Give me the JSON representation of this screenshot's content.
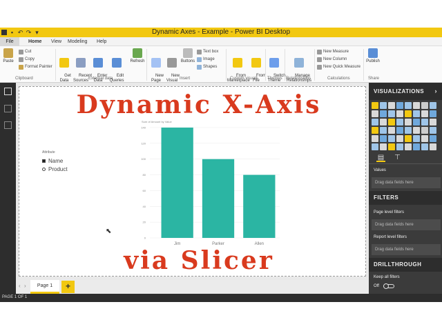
{
  "window": {
    "title": "Dynamic Axes - Example - Power BI Desktop"
  },
  "menu": {
    "file": "File",
    "tabs": [
      "Home",
      "View",
      "Modeling",
      "Help"
    ]
  },
  "ribbon": {
    "clipboard": {
      "paste": "Paste",
      "cut": "Cut",
      "copy": "Copy",
      "format_painter": "Format Painter",
      "group": "Clipboard"
    },
    "external_data": {
      "get_data": "Get\nData",
      "recent_sources": "Recent\nSources",
      "enter_data": "Enter\nData",
      "edit_queries": "Edit\nQueries",
      "refresh": "Refresh",
      "group": "External data"
    },
    "insert": {
      "new_page": "New\nPage",
      "new_visual": "New\nVisual",
      "buttons": "Buttons",
      "text_box": "Text box",
      "image": "Image",
      "shapes": "Shapes",
      "group": "Insert"
    },
    "custom_visuals": {
      "from_marketplace": "From\nMarketplace",
      "from_file": "From\nFile",
      "group": "Custom visuals"
    },
    "themes": {
      "switch_theme": "Switch\nTheme",
      "group": "Themes"
    },
    "relationships": {
      "manage": "Manage\nRelationships",
      "group": "Relationships"
    },
    "calculations": {
      "new_measure": "New Measure",
      "new_column": "New Column",
      "new_quick_measure": "New Quick Measure",
      "group": "Calculations"
    },
    "share": {
      "publish": "Publish",
      "group": "Share"
    }
  },
  "report": {
    "heading_top": "Dynamic X-Axis",
    "heading_bottom": "via Slicer",
    "slicer": {
      "label": "Attribute",
      "options": [
        {
          "label": "Name",
          "selected": true
        },
        {
          "label": "Product",
          "selected": false
        }
      ]
    }
  },
  "chart_data": {
    "type": "bar",
    "title": "Sum of Amount by Value",
    "categories": [
      "Jim",
      "Parker",
      "Allen"
    ],
    "values": [
      140,
      100,
      80
    ],
    "ylim": [
      0,
      140
    ],
    "yticks": [
      0,
      20,
      40,
      60,
      80,
      100,
      120,
      140
    ],
    "color": "#2bb5a3",
    "grid": true
  },
  "pages": {
    "tabs": [
      "Page 1"
    ],
    "add": "+"
  },
  "status": {
    "text": "PAGE 1 OF 1"
  },
  "pane": {
    "visualizations": "VISUALIZATIONS",
    "values_label": "Values",
    "drop_hint": "Drag data fields here",
    "filters": "FILTERS",
    "page_level": "Page level filters",
    "report_level": "Report level filters",
    "drillthrough": "DRILLTHROUGH",
    "keep_all_filters": "Keep all filters",
    "toggle_state": "Off"
  },
  "colors": {
    "accent": "#f2c811",
    "heading": "#d93a1e",
    "bar": "#2bb5a3",
    "pane": "#3b3b3b"
  }
}
